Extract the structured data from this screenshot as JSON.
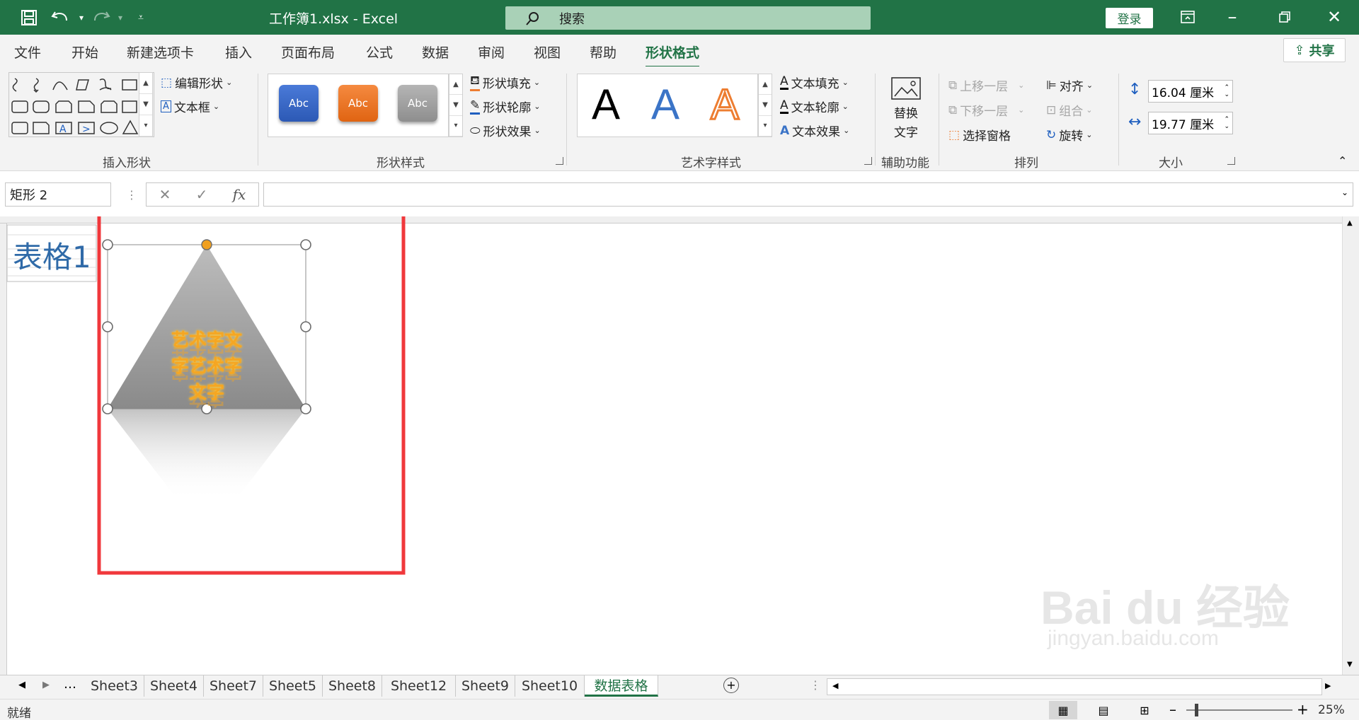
{
  "titlebar": {
    "file_title": "工作簿1.xlsx  -  Excel",
    "search_placeholder": "搜索",
    "login": "登录"
  },
  "tabs": [
    "文件",
    "开始",
    "新建选项卡",
    "插入",
    "页面布局",
    "公式",
    "数据",
    "审阅",
    "视图",
    "帮助",
    "形状格式"
  ],
  "active_tab": "形状格式",
  "share": "共享",
  "ribbon": {
    "insert_shapes": {
      "label": "插入形状",
      "edit_shape": "编辑形状",
      "textbox": "文本框"
    },
    "shape_styles": {
      "label": "形状样式",
      "presets": [
        "Abc",
        "Abc",
        "Abc"
      ],
      "fill": "形状填充",
      "outline": "形状轮廓",
      "effects": "形状效果"
    },
    "wordart": {
      "label": "艺术字样式",
      "samples": [
        "A",
        "A",
        "A"
      ],
      "fill": "文本填充",
      "outline": "文本轮廓",
      "effects": "文本效果"
    },
    "accessibility": {
      "label": "辅助功能",
      "alt_text": "替换\n文字",
      "alt_text_line1": "替换",
      "alt_text_line2": "文字"
    },
    "arrange": {
      "label": "排列",
      "bring_forward": "上移一层",
      "send_backward": "下移一层",
      "selection_pane": "选择窗格",
      "align": "对齐",
      "group": "组合",
      "rotate": "旋转"
    },
    "size": {
      "label": "大小",
      "height": "16.04 厘米",
      "width": "19.77 厘米"
    }
  },
  "formula": {
    "name_box": "矩形 2",
    "fx": "fx",
    "content": ""
  },
  "sheet": {
    "title_text": "表格1",
    "shape_text": "艺术字文字艺术字文字",
    "shape_lines": [
      "艺术字文",
      "字艺术字",
      "文字"
    ]
  },
  "sheet_tabs": [
    "Sheet3",
    "Sheet4",
    "Sheet7",
    "Sheet5",
    "Sheet8",
    "Sheet12",
    "Sheet9",
    "Sheet10",
    "数据表格"
  ],
  "active_sheet": "数据表格",
  "status": {
    "ready": "就绪",
    "zoom": "25%"
  },
  "colors": {
    "accent": "#217346",
    "highlight": "#f0383c",
    "shape_text": "#f5a623"
  }
}
